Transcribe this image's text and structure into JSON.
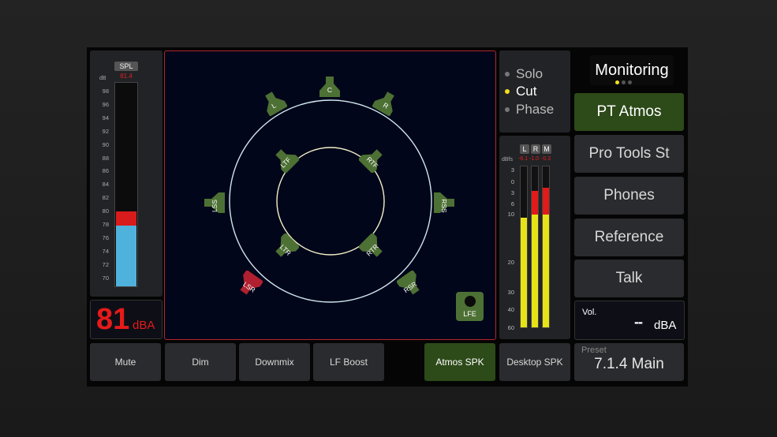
{
  "spl_meter": {
    "title": "SPL",
    "peak_value": "81.4",
    "unit": "dB",
    "ticks": [
      "98",
      "96",
      "94",
      "92",
      "90",
      "88",
      "86",
      "84",
      "82",
      "80",
      "78",
      "76",
      "74",
      "72",
      "70"
    ],
    "level_percent": 30,
    "peak_percent": 37
  },
  "spl_readout": {
    "value": "81",
    "unit": "dBA"
  },
  "speaker_map": {
    "speakers": [
      {
        "id": "C",
        "label": "C",
        "active": true
      },
      {
        "id": "L",
        "label": "L",
        "active": true
      },
      {
        "id": "R",
        "label": "R",
        "active": true
      },
      {
        "id": "LTF",
        "label": "LTF",
        "active": true
      },
      {
        "id": "RTF",
        "label": "RTF",
        "active": true
      },
      {
        "id": "LSS",
        "label": "LSS",
        "active": true
      },
      {
        "id": "RSS",
        "label": "RSS",
        "active": true
      },
      {
        "id": "LTR",
        "label": "LTR",
        "active": true
      },
      {
        "id": "RTR",
        "label": "RTR",
        "active": true
      },
      {
        "id": "LSR",
        "label": "LSR",
        "active": false
      },
      {
        "id": "RSR",
        "label": "RSR",
        "active": true
      }
    ],
    "lfe_label": "LFE",
    "colors": {
      "active": "#4d7134",
      "cut": "#b02030",
      "outer_ring": "#cfe6ee",
      "inner_ring": "#f2f0c8"
    }
  },
  "status": {
    "items": [
      {
        "label": "Solo",
        "on": false
      },
      {
        "label": "Cut",
        "on": true
      },
      {
        "label": "Phase",
        "on": false
      }
    ]
  },
  "output_meter": {
    "unit": "dBfs",
    "channels": [
      {
        "label": "L",
        "peak": "-6.1",
        "level_percent": 68
      },
      {
        "label": "R",
        "peak": "-1.0",
        "level_percent": 85
      },
      {
        "label": "M",
        "peak": "-0.3",
        "level_percent": 87
      }
    ],
    "ticks": [
      "3",
      "0",
      "3",
      "6",
      "10",
      "20",
      "30",
      "40",
      "60"
    ]
  },
  "monitoring": {
    "title": "Monitoring",
    "sources": [
      "PT Atmos",
      "Pro Tools St",
      "Phones",
      "Reference",
      "Talk"
    ],
    "active_source": "PT Atmos"
  },
  "volume": {
    "label": "Vol.",
    "value": "--",
    "unit": "dBA"
  },
  "bottom_bar": {
    "buttons": [
      "Mute",
      "Dim",
      "Downmix",
      "LF Boost"
    ],
    "speaker_sets": [
      "Atmos SPK",
      "Desktop SPK"
    ],
    "active_speaker_set": "Atmos SPK"
  },
  "preset": {
    "label": "Preset",
    "value": "7.1.4 Main"
  }
}
